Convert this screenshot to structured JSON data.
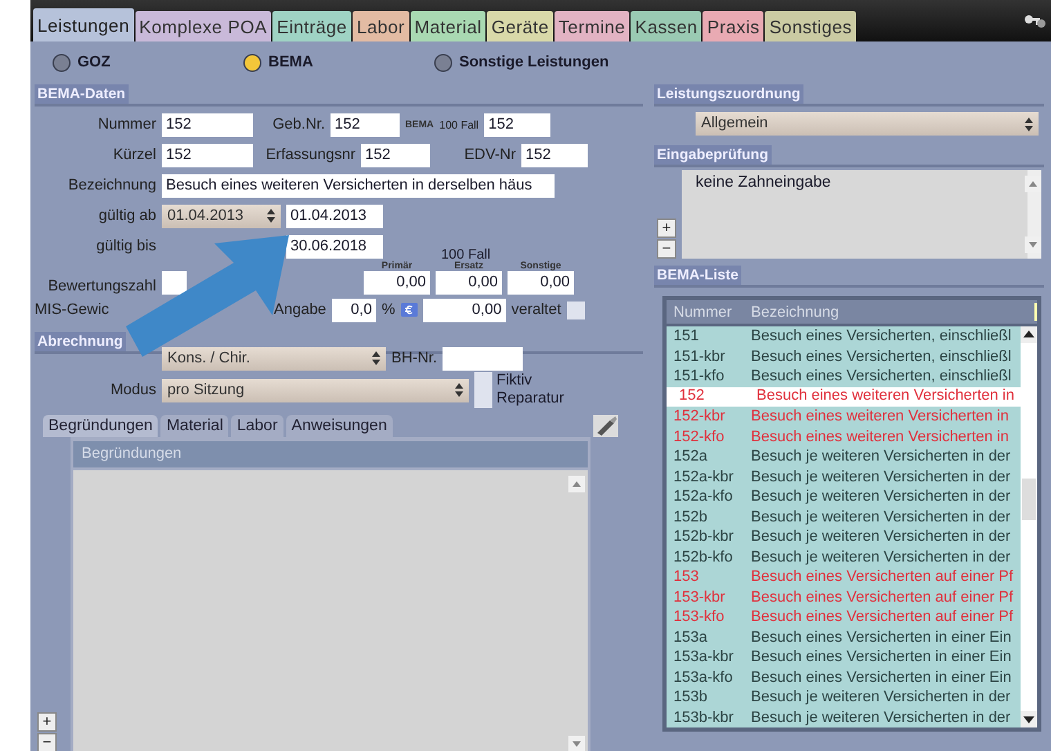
{
  "tabs": [
    {
      "label": "Leistungen",
      "color": "#b6c2da",
      "selected": true
    },
    {
      "label": "Komplexe POA",
      "color": "#c9b9d9",
      "selected": false
    },
    {
      "label": "Einträge",
      "color": "#9fd3c4",
      "selected": false
    },
    {
      "label": "Labor",
      "color": "#e3bba3",
      "selected": false
    },
    {
      "label": "Material",
      "color": "#a9d9b2",
      "selected": false
    },
    {
      "label": "Geräte",
      "color": "#d9d9a9",
      "selected": false
    },
    {
      "label": "Termine",
      "color": "#e2b3c3",
      "selected": false
    },
    {
      "label": "Kassen",
      "color": "#9acab3",
      "selected": false
    },
    {
      "label": "Praxis",
      "color": "#e9aab3",
      "selected": false
    },
    {
      "label": "Sonstiges",
      "color": "#cbcba3",
      "selected": false
    }
  ],
  "source_radios": [
    {
      "label": "GOZ",
      "selected": false
    },
    {
      "label": "BEMA",
      "selected": true
    },
    {
      "label": "Sonstige Leistungen",
      "selected": false
    }
  ],
  "bema_daten": {
    "title": "BEMA-Daten",
    "nummer": {
      "label": "Nummer",
      "value": "152"
    },
    "geb_nr": {
      "label": "Geb.Nr.",
      "value": "152"
    },
    "fall": {
      "label_small": "BEMA",
      "label": "100 Fall",
      "value": "152"
    },
    "kuerzel": {
      "label": "Kürzel",
      "value": "152"
    },
    "erfassungsnr": {
      "label": "Erfassungsnr",
      "value": "152"
    },
    "edv_nr": {
      "label": "EDV-Nr",
      "value": "152"
    },
    "bezeichnung": {
      "label": "Bezeichnung",
      "value": "Besuch eines weiteren Versicherten in derselben häus"
    },
    "gueltig_ab": {
      "label": "gültig ab",
      "option": "01.04.2013",
      "value": "01.04.2013"
    },
    "gueltig_bis": {
      "label": "gültig bis",
      "value": "30.06.2018"
    },
    "fall_header": "100 Fall",
    "fall_columns": [
      {
        "label": "Primär",
        "value": "0,00"
      },
      {
        "label": "Ersatz",
        "value": "0,00"
      },
      {
        "label": "Sonstige",
        "value": "0,00"
      }
    ],
    "bewertungszahl": {
      "label": "Bewertungszahl"
    },
    "mis": {
      "label": "MIS-Gewic",
      "angabe_label": "Angabe",
      "angabe_value": "0,0",
      "percent": "%",
      "amount": "0,00",
      "veraltet_label": "veraltet",
      "veraltet_checked": false
    }
  },
  "abrechnung": {
    "title": "Abrechnung",
    "kasse": "Kons. / Chir.",
    "bh_label": "BH-Nr.",
    "modus_label": "Modus",
    "modus": "pro Sitzung",
    "flags": [
      {
        "label": "Fiktiv",
        "checked": false
      },
      {
        "label": "Reparatur",
        "checked": false
      }
    ]
  },
  "subtabs": [
    {
      "label": "Begründungen",
      "selected": true
    },
    {
      "label": "Material",
      "selected": false
    },
    {
      "label": "Labor",
      "selected": false
    },
    {
      "label": "Anweisungen",
      "selected": false
    }
  ],
  "begruendungen": {
    "header": "Begründungen",
    "add": "+",
    "remove": "−"
  },
  "leistungszuordnung": {
    "title": "Leistungszuordnung",
    "value": "Allgemein"
  },
  "eingabepruefung": {
    "title": "Eingabeprüfung",
    "items": [
      "keine Zahneingabe"
    ],
    "add": "+",
    "remove": "−"
  },
  "bema_liste": {
    "title": "BEMA-Liste",
    "columns": [
      "Nummer",
      "Bezeichnung"
    ],
    "rows": [
      {
        "nummer": "151",
        "bezeichnung": "Besuch eines Versicherten, einschließl",
        "color": "#2c4444",
        "selected": false
      },
      {
        "nummer": "151-kbr",
        "bezeichnung": "Besuch eines Versicherten, einschließl",
        "color": "#2c4444",
        "selected": false
      },
      {
        "nummer": "151-kfo",
        "bezeichnung": "Besuch eines Versicherten, einschließl",
        "color": "#2c4444",
        "selected": false
      },
      {
        "nummer": "152",
        "bezeichnung": "Besuch eines weiteren Versicherten in",
        "color": "#e0303c",
        "selected": true
      },
      {
        "nummer": "152-kbr",
        "bezeichnung": "Besuch eines weiteren Versicherten in",
        "color": "#e0303c",
        "selected": false
      },
      {
        "nummer": "152-kfo",
        "bezeichnung": "Besuch eines weiteren Versicherten in",
        "color": "#e0303c",
        "selected": false
      },
      {
        "nummer": "152a",
        "bezeichnung": "Besuch je weiteren Versicherten in der",
        "color": "#2c4444",
        "selected": false
      },
      {
        "nummer": "152a-kbr",
        "bezeichnung": "Besuch je weiteren Versicherten in der",
        "color": "#2c4444",
        "selected": false
      },
      {
        "nummer": "152a-kfo",
        "bezeichnung": "Besuch je weiteren Versicherten in der",
        "color": "#2c4444",
        "selected": false
      },
      {
        "nummer": "152b",
        "bezeichnung": "Besuch je weiteren Versicherten in der",
        "color": "#2c4444",
        "selected": false
      },
      {
        "nummer": "152b-kbr",
        "bezeichnung": "Besuch je weiteren Versicherten in der",
        "color": "#2c4444",
        "selected": false
      },
      {
        "nummer": "152b-kfo",
        "bezeichnung": "Besuch je weiteren Versicherten in der",
        "color": "#2c4444",
        "selected": false
      },
      {
        "nummer": "153",
        "bezeichnung": "Besuch eines Versicherten auf einer Pf",
        "color": "#e0303c",
        "selected": false
      },
      {
        "nummer": "153-kbr",
        "bezeichnung": "Besuch eines Versicherten auf einer Pf",
        "color": "#e0303c",
        "selected": false
      },
      {
        "nummer": "153-kfo",
        "bezeichnung": "Besuch eines Versicherten auf einer Pf",
        "color": "#e0303c",
        "selected": false
      },
      {
        "nummer": "153a",
        "bezeichnung": "Besuch eines Versicherten in einer Ein",
        "color": "#2c4444",
        "selected": false
      },
      {
        "nummer": "153a-kbr",
        "bezeichnung": "Besuch eines Versicherten in einer Ein",
        "color": "#2c4444",
        "selected": false
      },
      {
        "nummer": "153a-kfo",
        "bezeichnung": "Besuch eines Versicherten in einer Ein",
        "color": "#2c4444",
        "selected": false
      },
      {
        "nummer": "153b",
        "bezeichnung": "Besuch je weiteren Versicherten in der",
        "color": "#2c4444",
        "selected": false
      },
      {
        "nummer": "153b-kbr",
        "bezeichnung": "Besuch je weiteren Versicherten in der",
        "color": "#2c4444",
        "selected": false
      }
    ]
  }
}
